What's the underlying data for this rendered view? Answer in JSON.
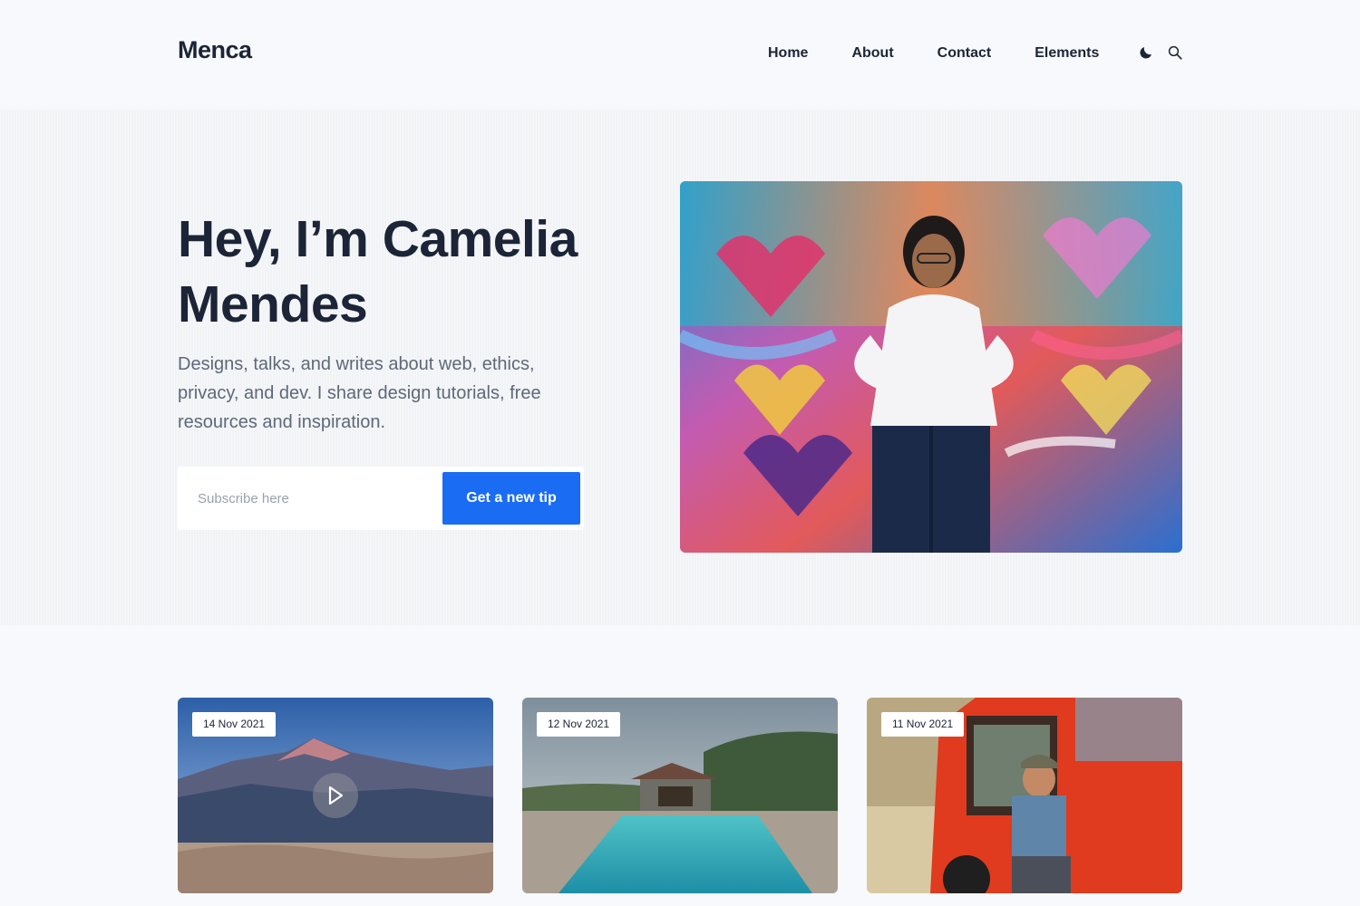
{
  "brand": {
    "name": "Menca"
  },
  "nav": {
    "items": [
      {
        "label": "Home"
      },
      {
        "label": "About"
      },
      {
        "label": "Contact"
      },
      {
        "label": "Elements"
      }
    ],
    "icons": [
      "moon-icon",
      "search-icon"
    ]
  },
  "hero": {
    "title": "Hey, I’m Camelia Mendes",
    "description": "Designs, talks, and writes about web, ethics, privacy, and dev. I share design tutorials, free resources and inspiration.",
    "subscribe": {
      "placeholder": "Subscribe here",
      "button_label": "Get a new tip"
    }
  },
  "posts": [
    {
      "date": "14 Nov 2021",
      "has_video": true
    },
    {
      "date": "12 Nov 2021",
      "has_video": false
    },
    {
      "date": "11 Nov 2021",
      "has_video": false
    }
  ],
  "colors": {
    "accent": "#1a6cf3",
    "text_dark": "#1c2437",
    "text_muted": "#5e6879",
    "background": "#f8f9fc"
  }
}
